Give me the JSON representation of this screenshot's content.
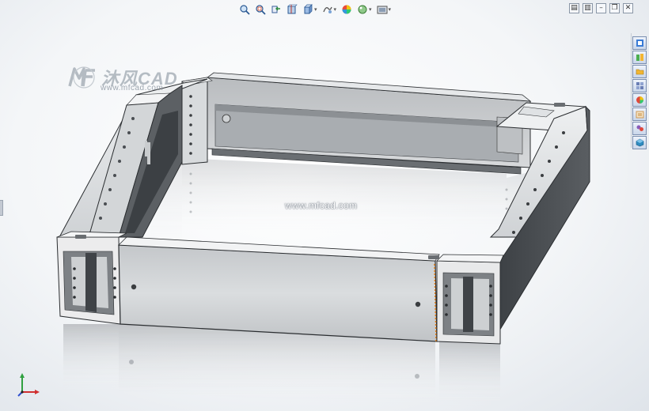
{
  "toolbar": {
    "buttons": [
      {
        "icon": "zoom-to-fit-icon",
        "dropdown": false
      },
      {
        "icon": "zoom-to-area-icon",
        "dropdown": false
      },
      {
        "icon": "previous-view-icon",
        "dropdown": false
      },
      {
        "icon": "section-view-icon",
        "dropdown": false
      },
      {
        "icon": "view-orientation-icon",
        "dropdown": true
      },
      {
        "icon": "display-style-icon",
        "dropdown": true
      },
      {
        "icon": "hide-show-items-icon",
        "dropdown": true
      },
      {
        "icon": "edit-appearance-icon",
        "dropdown": false
      },
      {
        "icon": "apply-scene-icon",
        "dropdown": true
      },
      {
        "icon": "view-settings-icon",
        "dropdown": true
      }
    ]
  },
  "window_controls": {
    "tile_horizontal": "▤",
    "tile_vertical": "▥",
    "minimize": "–",
    "restore": "❐",
    "close": "✕"
  },
  "task_pane": {
    "items": [
      {
        "icon": "solidworks-resources-icon",
        "color": "#3a7bd5"
      },
      {
        "icon": "design-library-icon",
        "color": "#4caf50"
      },
      {
        "icon": "file-explorer-icon",
        "color": "#f2b632"
      },
      {
        "icon": "view-palette-icon",
        "color": "#6a7fb5"
      },
      {
        "icon": "appearances-scenes-icon",
        "color": "#e0483a"
      },
      {
        "icon": "custom-properties-icon",
        "color": "#c98a3a"
      },
      {
        "icon": "solidworks-forum-icon",
        "color": "#8a5bb8"
      },
      {
        "icon": "3d-content-central-icon",
        "color": "#2e8bc0"
      }
    ]
  },
  "watermark": {
    "brand": "沐风CAD",
    "url": "www.mfcad.com",
    "center_url": "www.mfcad.com"
  },
  "triad": {
    "x_color": "#d03030",
    "y_color": "#30a040",
    "z_color": "#3050d0"
  },
  "colors": {
    "metal_light": "#d9dcde",
    "metal_mid": "#b4b8bc",
    "metal_dark": "#4a4e52",
    "edge": "#2a2d30",
    "accent_orange": "#e07a10"
  }
}
